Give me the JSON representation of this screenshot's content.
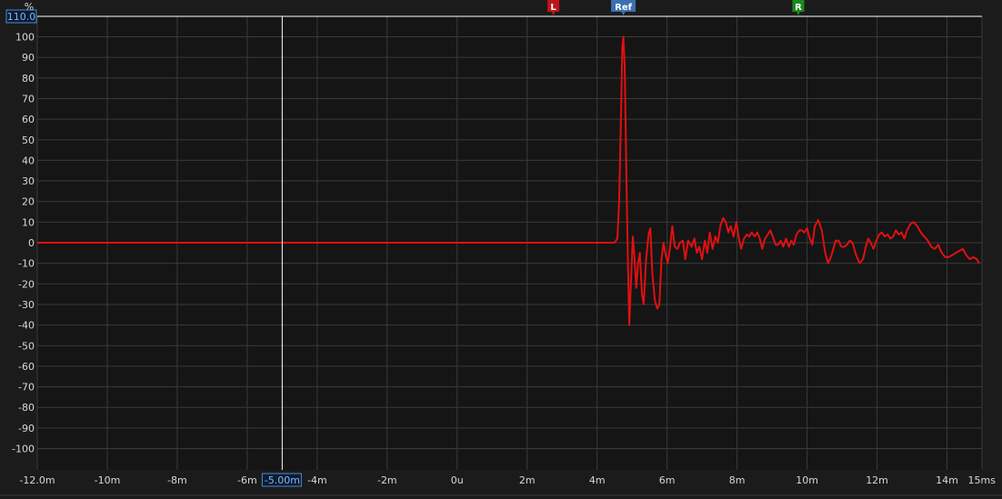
{
  "chart_data": {
    "type": "line",
    "y_unit": "%",
    "x_unit": "ms",
    "xlim": [
      -12,
      15
    ],
    "ylim": [
      -110,
      110
    ],
    "x_ticks": [
      {
        "v": -12,
        "label": "-12.0m"
      },
      {
        "v": -10,
        "label": "-10m"
      },
      {
        "v": -8,
        "label": "-8m"
      },
      {
        "v": -6,
        "label": "-6m"
      },
      {
        "v": -4,
        "label": "-4m"
      },
      {
        "v": -2,
        "label": "-2m"
      },
      {
        "v": 0,
        "label": "0u"
      },
      {
        "v": 2,
        "label": "2m"
      },
      {
        "v": 4,
        "label": "4m"
      },
      {
        "v": 6,
        "label": "6m"
      },
      {
        "v": 8,
        "label": "8m"
      },
      {
        "v": 10,
        "label": "10m"
      },
      {
        "v": 12,
        "label": "12m"
      },
      {
        "v": 14,
        "label": "14m"
      },
      {
        "v": 15,
        "label": "15ms"
      }
    ],
    "y_ticks": [
      100,
      90,
      80,
      70,
      60,
      50,
      40,
      30,
      20,
      10,
      0,
      -10,
      -20,
      -30,
      -40,
      -50,
      -60,
      -70,
      -80,
      -90,
      -100
    ],
    "y_top_readout": "110.0",
    "cursor": {
      "x": -5.0,
      "label": "-5.00m"
    },
    "markers": [
      {
        "label": "L",
        "x": 2.75,
        "color": "#c0141c"
      },
      {
        "label": "Ref",
        "x": 4.75,
        "color": "#3a6fb0"
      },
      {
        "label": "R",
        "x": 9.75,
        "color": "#1a8a1a"
      }
    ],
    "grid": true,
    "series": [
      {
        "color": "#e01010",
        "points": [
          [
            -12,
            0
          ],
          [
            4.5,
            0
          ],
          [
            4.58,
            2
          ],
          [
            4.63,
            20
          ],
          [
            4.68,
            60
          ],
          [
            4.72,
            95
          ],
          [
            4.75,
            100
          ],
          [
            4.79,
            85
          ],
          [
            4.84,
            30
          ],
          [
            4.88,
            -10
          ],
          [
            4.92,
            -40
          ],
          [
            4.97,
            -18
          ],
          [
            5.02,
            3
          ],
          [
            5.07,
            -8
          ],
          [
            5.12,
            -22
          ],
          [
            5.17,
            -10
          ],
          [
            5.22,
            -5
          ],
          [
            5.28,
            -25
          ],
          [
            5.33,
            -30
          ],
          [
            5.4,
            -8
          ],
          [
            5.47,
            4
          ],
          [
            5.52,
            7
          ],
          [
            5.58,
            -15
          ],
          [
            5.65,
            -28
          ],
          [
            5.72,
            -32
          ],
          [
            5.78,
            -30
          ],
          [
            5.84,
            -8
          ],
          [
            5.9,
            0
          ],
          [
            5.95,
            -5
          ],
          [
            6.02,
            -10
          ],
          [
            6.08,
            -3
          ],
          [
            6.15,
            8
          ],
          [
            6.22,
            -2
          ],
          [
            6.3,
            -3
          ],
          [
            6.37,
            0
          ],
          [
            6.45,
            1
          ],
          [
            6.52,
            -8
          ],
          [
            6.6,
            1
          ],
          [
            6.7,
            -2
          ],
          [
            6.78,
            2
          ],
          [
            6.85,
            -5
          ],
          [
            6.92,
            -2
          ],
          [
            7.0,
            -8
          ],
          [
            7.08,
            1
          ],
          [
            7.15,
            -5
          ],
          [
            7.22,
            5
          ],
          [
            7.3,
            -3
          ],
          [
            7.38,
            3
          ],
          [
            7.45,
            0
          ],
          [
            7.52,
            8
          ],
          [
            7.6,
            12
          ],
          [
            7.68,
            10
          ],
          [
            7.75,
            5
          ],
          [
            7.82,
            8
          ],
          [
            7.9,
            3
          ],
          [
            7.98,
            10
          ],
          [
            8.05,
            2
          ],
          [
            8.12,
            -3
          ],
          [
            8.2,
            2
          ],
          [
            8.28,
            4
          ],
          [
            8.35,
            3
          ],
          [
            8.42,
            5
          ],
          [
            8.5,
            3
          ],
          [
            8.58,
            5
          ],
          [
            8.65,
            2
          ],
          [
            8.72,
            -3
          ],
          [
            8.8,
            2
          ],
          [
            8.88,
            4
          ],
          [
            8.95,
            6
          ],
          [
            9.02,
            3
          ],
          [
            9.1,
            -1
          ],
          [
            9.18,
            -1
          ],
          [
            9.25,
            1
          ],
          [
            9.32,
            -2
          ],
          [
            9.4,
            2
          ],
          [
            9.48,
            -2
          ],
          [
            9.55,
            1
          ],
          [
            9.62,
            -1
          ],
          [
            9.7,
            4
          ],
          [
            9.78,
            6
          ],
          [
            9.85,
            6
          ],
          [
            9.92,
            5
          ],
          [
            10.0,
            7
          ],
          [
            10.08,
            2
          ],
          [
            10.15,
            -1
          ],
          [
            10.22,
            8
          ],
          [
            10.32,
            11
          ],
          [
            10.42,
            6
          ],
          [
            10.52,
            -5
          ],
          [
            10.6,
            -10
          ],
          [
            10.68,
            -7
          ],
          [
            10.75,
            -3
          ],
          [
            10.82,
            1
          ],
          [
            10.9,
            1
          ],
          [
            10.98,
            -2
          ],
          [
            11.06,
            -2
          ],
          [
            11.14,
            -1
          ],
          [
            11.22,
            1
          ],
          [
            11.3,
            0
          ],
          [
            11.4,
            -6
          ],
          [
            11.5,
            -10
          ],
          [
            11.6,
            -8
          ],
          [
            11.68,
            -2
          ],
          [
            11.75,
            2
          ],
          [
            11.82,
            0
          ],
          [
            11.9,
            -3
          ],
          [
            11.98,
            1
          ],
          [
            12.06,
            4
          ],
          [
            12.14,
            5
          ],
          [
            12.22,
            3
          ],
          [
            12.3,
            4
          ],
          [
            12.38,
            2
          ],
          [
            12.46,
            3
          ],
          [
            12.54,
            6
          ],
          [
            12.62,
            4
          ],
          [
            12.7,
            5
          ],
          [
            12.78,
            2
          ],
          [
            12.86,
            6
          ],
          [
            12.95,
            9
          ],
          [
            13.05,
            10
          ],
          [
            13.15,
            8
          ],
          [
            13.25,
            5
          ],
          [
            13.35,
            3
          ],
          [
            13.45,
            1
          ],
          [
            13.55,
            -2
          ],
          [
            13.65,
            -3
          ],
          [
            13.75,
            -1
          ],
          [
            13.85,
            -5
          ],
          [
            13.95,
            -7
          ],
          [
            14.05,
            -7
          ],
          [
            14.15,
            -6
          ],
          [
            14.25,
            -5
          ],
          [
            14.35,
            -4
          ],
          [
            14.45,
            -3
          ],
          [
            14.55,
            -6
          ],
          [
            14.65,
            -8
          ],
          [
            14.75,
            -7
          ],
          [
            14.85,
            -8
          ],
          [
            14.92,
            -10
          ]
        ]
      }
    ]
  }
}
